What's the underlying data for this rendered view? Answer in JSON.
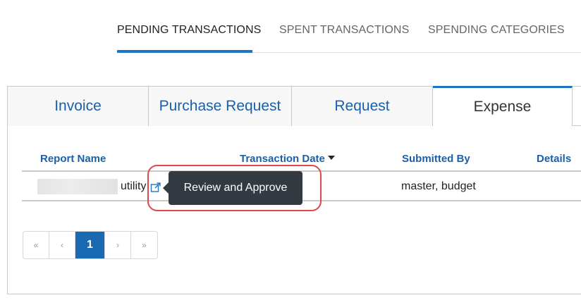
{
  "top_tabs": [
    {
      "label": "PENDING TRANSACTIONS",
      "active": true
    },
    {
      "label": "SPENT TRANSACTIONS",
      "active": false
    },
    {
      "label": "SPENDING CATEGORIES",
      "active": false
    }
  ],
  "sub_tabs": [
    {
      "label": "Invoice",
      "active": false
    },
    {
      "label": "Purchase Request",
      "active": false
    },
    {
      "label": "Request",
      "active": false
    },
    {
      "label": "Expense",
      "active": true
    }
  ],
  "table": {
    "headers": {
      "report_name": "Report Name",
      "transaction_date": "Transaction Date",
      "submitted_by": "Submitted By",
      "details": "Details"
    },
    "sort": {
      "column": "Transaction Date",
      "direction": "descending"
    },
    "rows": [
      {
        "report_name_suffix": "utility",
        "submitted_by": "master, budget",
        "action_icon": "external-link-icon"
      }
    ]
  },
  "tooltip": {
    "text": "Review and Approve"
  },
  "pagination": {
    "first": "«",
    "prev": "‹",
    "current": "1",
    "next": "›",
    "last": "»"
  },
  "colors": {
    "accent": "#1f75c4",
    "link": "#1a5fa8",
    "tooltip_bg": "#343a42",
    "highlight": "#e0474c",
    "page_active": "#1a69b3"
  }
}
